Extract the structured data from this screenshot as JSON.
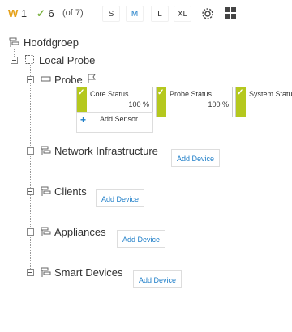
{
  "toolbar": {
    "warn_letter": "W",
    "warn_count": "1",
    "ok_check": "✓",
    "ok_count": "6",
    "of_text": "(of 7)",
    "sizes": [
      "S",
      "M",
      "L",
      "XL"
    ],
    "active_size": "M"
  },
  "tree": {
    "root": "Hoofdgroep",
    "probe_node": "Local Probe",
    "probe_device": "Probe",
    "sensors": [
      {
        "name": "Core Status",
        "value": "100 %"
      },
      {
        "name": "Probe Status",
        "value": "100 %"
      },
      {
        "name": "System Status",
        "value": ""
      }
    ],
    "add_sensor": "Add Sensor",
    "groups": [
      {
        "label": "Network Infrastructure",
        "add": "Add Device"
      },
      {
        "label": "Clients",
        "add": "Add Device"
      },
      {
        "label": "Appliances",
        "add": "Add Device"
      },
      {
        "label": "Smart Devices",
        "add": "Add Device"
      }
    ]
  },
  "colors": {
    "sensor_ok": "#b5c81e",
    "link": "#1e7ec8",
    "warning": "#e5a11a",
    "ok": "#7cb342"
  }
}
